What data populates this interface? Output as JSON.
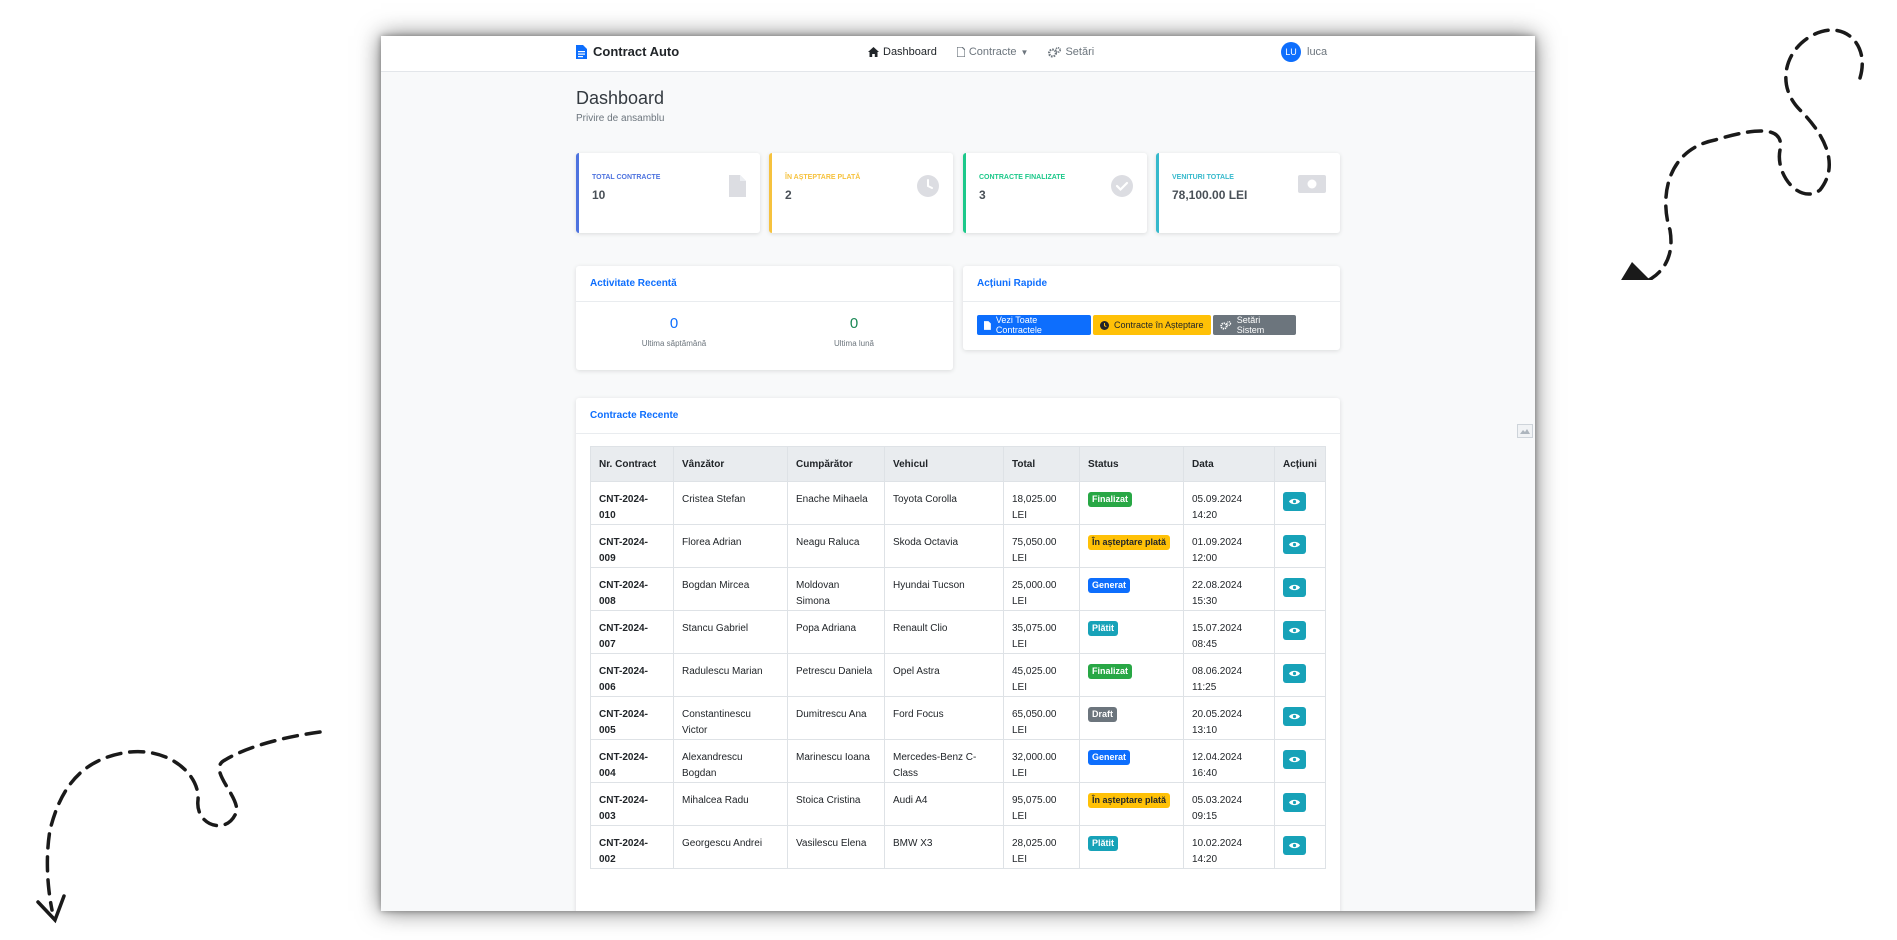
{
  "navbar": {
    "brand": "Contract Auto",
    "links": [
      {
        "label": "Dashboard",
        "icon": "home-icon"
      },
      {
        "label": "Contracte",
        "icon": "file-icon"
      },
      {
        "label": "Setări",
        "icon": "gears-icon"
      }
    ],
    "user": {
      "initials": "LU",
      "name": "luca"
    }
  },
  "page": {
    "title": "Dashboard",
    "subtitle": "Privire de ansamblu"
  },
  "stats": [
    {
      "label": "TOTAL CONTRACTE",
      "value": "10",
      "color": "#4e73df",
      "icon": "file-icon"
    },
    {
      "label": "ÎN AȘTEPTARE PLATĂ",
      "value": "2",
      "color": "#f6c23e",
      "icon": "clock-icon"
    },
    {
      "label": "CONTRACTE FINALIZATE",
      "value": "3",
      "color": "#1cc88a",
      "icon": "check-circle-icon"
    },
    {
      "label": "VENITURI TOTALE",
      "value": "78,100.00 LEI",
      "color": "#36b9cc",
      "icon": "money-icon"
    }
  ],
  "activity": {
    "title": "Activitate Recentă",
    "week": {
      "value": "0",
      "label": "Ultima săptămână",
      "color": "#0d6efd"
    },
    "month": {
      "value": "0",
      "label": "Ultima lună",
      "color": "#198754"
    }
  },
  "quick_actions": {
    "title": "Acțiuni Rapide",
    "buttons": [
      {
        "label": "Vezi Toate Contractele",
        "icon": "file-icon",
        "color": "#0d6efd"
      },
      {
        "label": "Contracte în Așteptare",
        "icon": "clock-icon",
        "color": "#ffc107"
      },
      {
        "label": "Setări Sistem",
        "icon": "gears-icon",
        "color": "#6c757d"
      }
    ]
  },
  "recent": {
    "title": "Contracte Recente",
    "columns": [
      "Nr. Contract",
      "Vânzător",
      "Cumpărător",
      "Vehicul",
      "Total",
      "Status",
      "Data",
      "Acțiuni"
    ],
    "rows": [
      {
        "nr": [
          "CNT-2024-",
          "010"
        ],
        "seller": [
          "Cristea Stefan"
        ],
        "buyer": [
          "Enache Mihaela"
        ],
        "vehicle": [
          "Toyota Corolla"
        ],
        "total": [
          "18,025.00",
          "LEI"
        ],
        "status": "Finalizat",
        "status_color": "#28a745",
        "status_text": "#ffffff",
        "date": [
          "05.09.2024",
          "14:20"
        ]
      },
      {
        "nr": [
          "CNT-2024-",
          "009"
        ],
        "seller": [
          "Florea Adrian"
        ],
        "buyer": [
          "Neagu Raluca"
        ],
        "vehicle": [
          "Skoda Octavia"
        ],
        "total": [
          "75,050.00",
          "LEI"
        ],
        "status": "În așteptare plată",
        "status_color": "#ffc107",
        "status_text": "#212529",
        "date": [
          "01.09.2024",
          "12:00"
        ]
      },
      {
        "nr": [
          "CNT-2024-",
          "008"
        ],
        "seller": [
          "Bogdan Mircea"
        ],
        "buyer": [
          "Moldovan",
          "Simona"
        ],
        "vehicle": [
          "Hyundai Tucson"
        ],
        "total": [
          "25,000.00",
          "LEI"
        ],
        "status": "Generat",
        "status_color": "#0d6efd",
        "status_text": "#ffffff",
        "date": [
          "22.08.2024",
          "15:30"
        ]
      },
      {
        "nr": [
          "CNT-2024-",
          "007"
        ],
        "seller": [
          "Stancu Gabriel"
        ],
        "buyer": [
          "Popa Adriana"
        ],
        "vehicle": [
          "Renault Clio"
        ],
        "total": [
          "35,075.00",
          "LEI"
        ],
        "status": "Plătit",
        "status_color": "#17a2b8",
        "status_text": "#ffffff",
        "date": [
          "15.07.2024",
          "08:45"
        ]
      },
      {
        "nr": [
          "CNT-2024-",
          "006"
        ],
        "seller": [
          "Radulescu Marian"
        ],
        "buyer": [
          "Petrescu Daniela"
        ],
        "vehicle": [
          "Opel Astra"
        ],
        "total": [
          "45,025.00",
          "LEI"
        ],
        "status": "Finalizat",
        "status_color": "#28a745",
        "status_text": "#ffffff",
        "date": [
          "08.06.2024",
          "11:25"
        ]
      },
      {
        "nr": [
          "CNT-2024-",
          "005"
        ],
        "seller": [
          "Constantinescu",
          "Victor"
        ],
        "buyer": [
          "Dumitrescu Ana"
        ],
        "vehicle": [
          "Ford Focus"
        ],
        "total": [
          "65,050.00",
          "LEI"
        ],
        "status": "Draft",
        "status_color": "#6c757d",
        "status_text": "#ffffff",
        "date": [
          "20.05.2024",
          "13:10"
        ]
      },
      {
        "nr": [
          "CNT-2024-",
          "004"
        ],
        "seller": [
          "Alexandrescu",
          "Bogdan"
        ],
        "buyer": [
          "Marinescu Ioana"
        ],
        "vehicle": [
          "Mercedes-Benz C-",
          "Class"
        ],
        "total": [
          "32,000.00",
          "LEI"
        ],
        "status": "Generat",
        "status_color": "#0d6efd",
        "status_text": "#ffffff",
        "date": [
          "12.04.2024",
          "16:40"
        ]
      },
      {
        "nr": [
          "CNT-2024-",
          "003"
        ],
        "seller": [
          "Mihalcea Radu"
        ],
        "buyer": [
          "Stoica Cristina"
        ],
        "vehicle": [
          "Audi A4"
        ],
        "total": [
          "95,075.00",
          "LEI"
        ],
        "status": "În așteptare plată",
        "status_color": "#ffc107",
        "status_text": "#212529",
        "date": [
          "05.03.2024",
          "09:15"
        ]
      },
      {
        "nr": [
          "CNT-2024-",
          "002"
        ],
        "seller": [
          "Georgescu Andrei"
        ],
        "buyer": [
          "Vasilescu Elena"
        ],
        "vehicle": [
          "BMW X3"
        ],
        "total": [
          "28,025.00",
          "LEI"
        ],
        "status": "Plătit",
        "status_color": "#17a2b8",
        "status_text": "#ffffff",
        "date": [
          "10.02.2024",
          "14:20"
        ]
      }
    ]
  }
}
